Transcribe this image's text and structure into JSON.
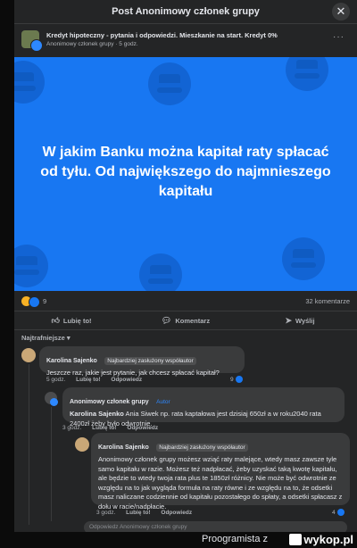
{
  "dialog": {
    "title": "Post Anonimowy członek grupy",
    "close_icon": "close-icon"
  },
  "post": {
    "group_name": "Kredyt hipoteczny - pytania i odpowiedzi. Mieszkanie na start. Kredyt 0%",
    "author": "Anonimowy członek grupy",
    "time": "5 godz.",
    "more": "···",
    "banner_text": "W jakim Banku można kapitał raty spłacać od tyłu. Od największego do najmnieszego kapitału",
    "banner_color": "#1877f2",
    "reaction_count": "9",
    "comment_count": "32 komentarze"
  },
  "actions": {
    "like": "Lubię to!",
    "comment": "Komentarz",
    "send": "Wyślij"
  },
  "sort": {
    "label": "Najtrafniejsze"
  },
  "comments": [
    {
      "name": "Karolina Sajenko",
      "badge": "Najbardziej zasłużony współautor",
      "text": "Jeszcze raz, jakie jest pytanie, jak chcesz spłacać kapitał?",
      "time": "5 godz.",
      "like": "Lubię to!",
      "reply": "Odpowiedz",
      "reactions": "9"
    },
    {
      "name": "Anonimowy członek grupy",
      "badge": "Autor",
      "text_mention": "Karolina Sajenko",
      "text": " Ania Siwek np. rata kaptałowa jest dzisiaj 650zł a w roku2040 rata 2400zł żeby było odwrotnie.",
      "time": "3 godz.",
      "like": "Lubię to!",
      "reply": "Odpowiedz"
    },
    {
      "name": "Karolina Sajenko",
      "badge": "Najbardziej zasłużony współautor",
      "text": "Anonimowy członek grupy możesz wziąć raty malejące, wtedy masz zawsze tyle samo kapitału w razie. Możesz też nadpłacać, żeby uzyskać taką kwotę kapitału, ale będzie to wtedy twoja rata plus te 1850zł różnicy. Nie może być odwrotnie ze względu na to jak wygląda formuła na raty równe i ze względu na to, że odsetki masz naliczane codziennie od kapitału pozostałego do spłaty, a odsetki spłacasz z dołu w racie/nadpłacie.",
      "time": "3 godz.",
      "like": "Lubię to!",
      "reply": "Odpowiedz",
      "reactions": "4"
    }
  ],
  "reply_placeholder": "Odpowiedz Anonimowy członek grupy",
  "footer": {
    "user": "Proogramista",
    "separator": "z",
    "logo": "wykop.pl"
  }
}
